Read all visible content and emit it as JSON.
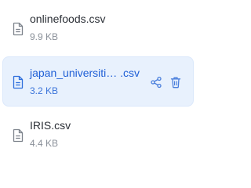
{
  "files": [
    {
      "name": "onlinefoods.csv",
      "size": "9.9 KB",
      "icon": "file-icon"
    },
    {
      "name": "japan_universiti… .csv",
      "size": "3.2 KB",
      "icon": "file-icon",
      "selected": true,
      "actions": [
        "share-icon",
        "trash-icon"
      ]
    },
    {
      "name": "IRIS.csv",
      "size": "4.4 KB",
      "icon": "file-icon"
    }
  ],
  "colors": {
    "selected_bg": "#e8f1fd",
    "selected_text": "#1f5fd6",
    "text": "#2b2f36",
    "muted": "#8a9099"
  }
}
